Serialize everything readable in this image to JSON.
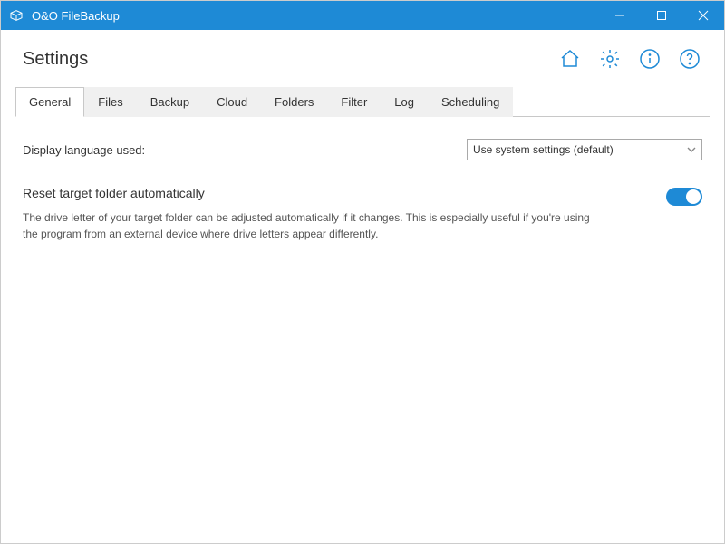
{
  "titlebar": {
    "app_title": "O&O FileBackup"
  },
  "header": {
    "title": "Settings"
  },
  "tabs": [
    {
      "label": "General",
      "active": true
    },
    {
      "label": "Files",
      "active": false
    },
    {
      "label": "Backup",
      "active": false
    },
    {
      "label": "Cloud",
      "active": false
    },
    {
      "label": "Folders",
      "active": false
    },
    {
      "label": "Filter",
      "active": false
    },
    {
      "label": "Log",
      "active": false
    },
    {
      "label": "Scheduling",
      "active": false
    }
  ],
  "settings": {
    "language_label": "Display language used:",
    "language_value": "Use system settings (default)",
    "reset_target_title": "Reset target folder automatically",
    "reset_target_desc": "The drive letter of your target folder can be adjusted automatically if it changes. This is especially useful if you're using the program from an external device where drive letters appear differently.",
    "reset_target_on": true
  }
}
